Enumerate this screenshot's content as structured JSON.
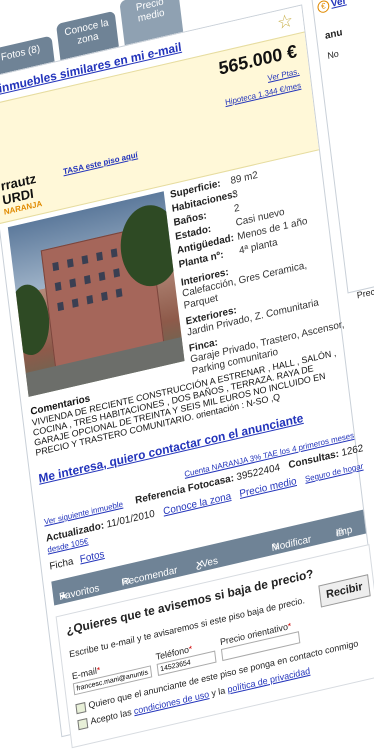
{
  "tabs": [
    "Fotos (8)",
    "Conoce la zona",
    "Precio medio"
  ],
  "alert_link": "r inmuebles similares en mi e-mail",
  "price": "565.000 €",
  "price_links": [
    "Ver Ptas.",
    "Hipoteca 1.344 €/mes"
  ],
  "location": {
    "city": "rrautz",
    "district": "URDI"
  },
  "badge": "NARANJA",
  "tasa_link": "TASA este piso aquí",
  "specs": [
    {
      "label": "Superficie:",
      "value": "89 m2"
    },
    {
      "label": "Habitaciones:",
      "value": "3"
    },
    {
      "label": "Baños:",
      "value": "2"
    },
    {
      "label": "Estado:",
      "value": "Casi nuevo"
    },
    {
      "label": "Antigüedad:",
      "value": "Menos de 1 año"
    },
    {
      "label": "Planta nº:",
      "value": "4ª planta"
    }
  ],
  "interiores": {
    "label": "Interiores:",
    "value": "Calefacción, Gres Ceramica, Parquet"
  },
  "exteriores": {
    "label": "Exteriores:",
    "value": "Jardin Privado, Z. Comunitaria"
  },
  "finca": {
    "label": "Finca:",
    "value": "Garaje Privado, Trastero, Ascensor, Parking comunitario"
  },
  "comments": {
    "label": "Comentarios",
    "text": "VIVIENDA DE RECIENTE CONSTRUCCIÓN A ESTRENAR , HALL , SALÓN , COCINA , TRES HABITACIONES , DOS BAÑOS , TERRAZA. RAYA DE GARAJE OPCIONAL DE TREINTA Y SEIS MIL EUROS NO INCLUIDO EN PRECIO Y TRASTERO COMUNITARIO. orientación : N-SO ,Q"
  },
  "contact_link": "Me interesa, quiero contactar con el anunciante",
  "naranja_link": "Cuenta NARANJA 3% TAE los 4 primeros meses",
  "next_link": "Ver siguiente inmueble",
  "reference": {
    "label": "Referencia Fotocasa:",
    "value": "39522404"
  },
  "consultas": {
    "label": "Consultas:",
    "value": "1262"
  },
  "actualizado": {
    "label": "Actualizado:",
    "value": "11/01/2010"
  },
  "conoce_link": "Conoce la zona",
  "precio_link": "Precio medio",
  "seguro_link": "Seguro de hogar desde 105€",
  "ficha": {
    "label": "Ficha",
    "fotos": "Fotos"
  },
  "actions": [
    "Favoritos",
    "Recomendar",
    "¿Ves un error?",
    "Modificar",
    "Imp"
  ],
  "precio_act": "Precio act",
  "notify": {
    "title": "¿Quieres que te avisemos si baja de precio?",
    "subtitle": "Escribe tu e-mail y te avisaremos si este piso baja de precio.",
    "email_label": "E-mail",
    "email_value": "francesc.mani@anuntis.com",
    "phone_label": "Teléfono",
    "phone_value": "14523654",
    "price_label": "Precio orientativo",
    "button": "Recibir",
    "check1": "Quiero que el anunciante de este piso se ponga en contacto conmigo",
    "check2_pre": "Acepto las",
    "check2_link1": "condiciones de uso",
    "check2_mid": "y la",
    "check2_link2": "política de privacidad"
  },
  "right": {
    "link": "Ver",
    "word": "anu",
    "label": "No"
  },
  "colors": {
    "tab": "#6f8396",
    "link": "#2233bb",
    "price_bar": "#fff8d8",
    "badge": "#e08a00"
  }
}
